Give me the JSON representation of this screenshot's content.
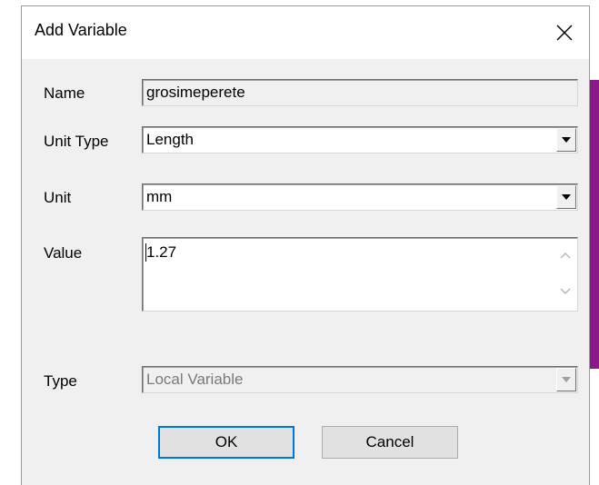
{
  "dialog": {
    "title": "Add Variable",
    "close_icon": "close-icon"
  },
  "form": {
    "name_label": "Name",
    "name_value": "grosimeperete",
    "unit_type_label": "Unit Type",
    "unit_type_value": "Length",
    "unit_label": "Unit",
    "unit_value": "mm",
    "value_label": "Value",
    "value_value": "1.27",
    "type_label": "Type",
    "type_value": "Local Variable"
  },
  "buttons": {
    "ok_label": "OK",
    "cancel_label": "Cancel"
  },
  "colors": {
    "side_accent": "#8a1a8a",
    "ok_focus": "#0078d7"
  }
}
